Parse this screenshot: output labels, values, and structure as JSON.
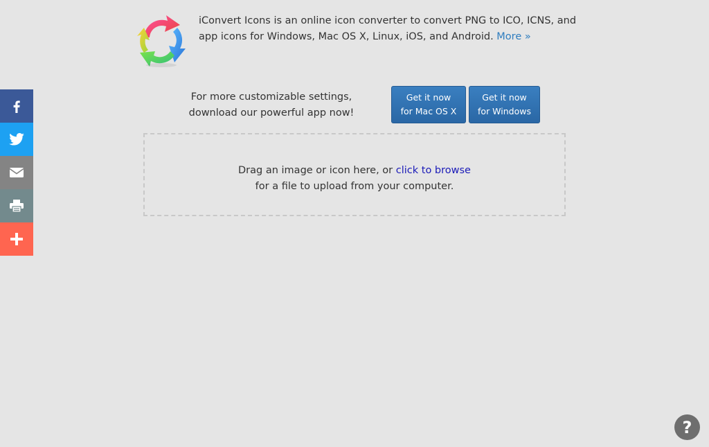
{
  "intro": {
    "text": "iConvert Icons is an online icon converter to convert PNG to ICO, ICNS, and app icons for Windows, Mac OS X, Linux, iOS, and Android.",
    "more_link": "More »"
  },
  "promo": {
    "line1": "For more customizable settings,",
    "line2": "download our powerful app now!",
    "mac_button": {
      "line1": "Get it now",
      "line2": "for Mac OS X"
    },
    "win_button": {
      "line1": "Get it now",
      "line2": "for Windows"
    }
  },
  "dropzone": {
    "text_before_link": "Drag an image or icon here, or",
    "link": "click to browse",
    "line2": "for a file to upload from your computer."
  },
  "share": {
    "items": [
      {
        "icon": "facebook-icon",
        "color": "#3b5998"
      },
      {
        "icon": "twitter-icon",
        "color": "#1da1f2"
      },
      {
        "icon": "email-icon",
        "color": "#848484"
      },
      {
        "icon": "print-icon",
        "color": "#738a8d"
      },
      {
        "icon": "plus-icon",
        "color": "#ff6550"
      }
    ]
  },
  "help": {
    "label": "?"
  },
  "colors": {
    "background": "#e5e5e5",
    "button": "#2f72b3",
    "link": "#2f7dbf"
  }
}
